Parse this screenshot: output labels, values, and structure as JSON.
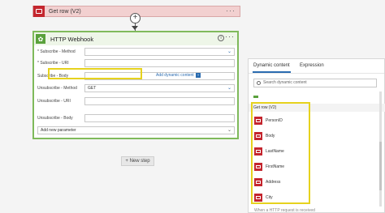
{
  "getrow": {
    "title": "Get row (V2)",
    "more": "···"
  },
  "connector": {
    "plus": "+"
  },
  "webhook": {
    "title": "HTTP Webhook",
    "info": "i",
    "more": "···",
    "fields": [
      {
        "label": "* Subscribe - Method",
        "value": ""
      },
      {
        "label": "* Subscribe - URI",
        "value": ""
      },
      {
        "label": "Subscribe - Body",
        "value": ""
      },
      {
        "label": "Unsubscribe - Method",
        "value": "GET"
      },
      {
        "label": "Unsubscribe - URI",
        "value": ""
      },
      {
        "label": "Unsubscribe - Body",
        "value": ""
      }
    ],
    "add_dynamic": "Add dynamic content",
    "add_dynamic_icon": "+",
    "add_param": "Add new parameter"
  },
  "new_step": "+ New step",
  "panel": {
    "tab_dynamic": "Dynamic content",
    "tab_expression": "Expression",
    "search_placeholder": "Search dynamic content",
    "section": "Get row (V2)",
    "items": [
      "PersonID",
      "Body",
      "LastName",
      "FirstName",
      "Address",
      "City"
    ],
    "footer": "When a HTTP request is received"
  },
  "colors": {
    "accent": "#2b6cb0",
    "highlight": "#e6d21e",
    "sql_red": "#c4262e",
    "webhook_green": "#7fba5b"
  }
}
